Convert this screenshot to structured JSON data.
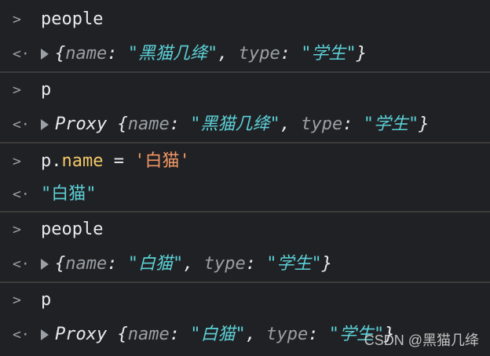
{
  "console": {
    "rows": [
      {
        "prompt": ">",
        "text": "people"
      },
      {
        "prompt": "<·",
        "object": {
          "prefix": "",
          "name_key": "name",
          "name_val": "\"黑猫几绛\"",
          "type_key": "type",
          "type_val": "\"学生\""
        }
      },
      {
        "prompt": ">",
        "text": "p"
      },
      {
        "prompt": "<·",
        "object": {
          "prefix": "Proxy ",
          "name_key": "name",
          "name_val": "\"黑猫几绛\"",
          "type_key": "type",
          "type_val": "\"学生\""
        }
      },
      {
        "prompt": ">",
        "code": {
          "obj": "p.",
          "prop": "name",
          "op": " = ",
          "lit": "'白猫'"
        }
      },
      {
        "prompt": "<·",
        "string": "\"白猫\""
      },
      {
        "prompt": ">",
        "text": "people"
      },
      {
        "prompt": "<·",
        "object": {
          "prefix": "",
          "name_key": "name",
          "name_val": "\"白猫\"",
          "type_key": "type",
          "type_val": "\"学生\""
        }
      },
      {
        "prompt": ">",
        "text": "p"
      },
      {
        "prompt": "<·",
        "object": {
          "prefix": "Proxy ",
          "name_key": "name",
          "name_val": "\"白猫\"",
          "type_key": "type",
          "type_val": "\"学生\""
        }
      }
    ]
  },
  "watermark": "CSDN @黑猫几绛"
}
